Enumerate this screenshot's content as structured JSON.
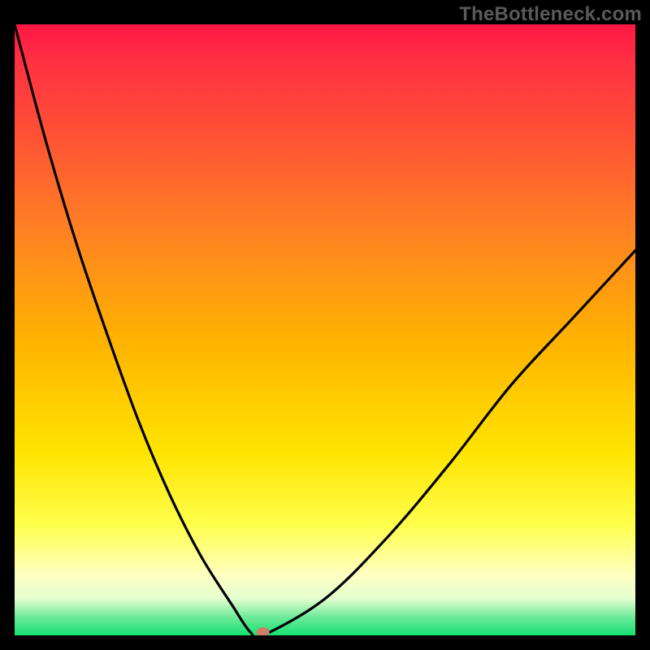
{
  "watermark": "TheBottleneck.com",
  "chart_data": {
    "type": "line",
    "title": "",
    "xlabel": "",
    "ylabel": "",
    "x": [
      0,
      5,
      10,
      15,
      20,
      25,
      30,
      35,
      38,
      40,
      50,
      60,
      70,
      80,
      90,
      100
    ],
    "values": [
      100,
      81,
      64,
      49,
      35,
      23,
      13,
      5,
      0.5,
      0,
      6,
      16,
      28,
      41,
      52,
      63
    ],
    "xlim": [
      0,
      100
    ],
    "ylim": [
      0,
      100
    ],
    "marker": {
      "x": 40,
      "y": 0
    },
    "background_gradient": {
      "type": "vertical",
      "stops": [
        {
          "pos": 0.0,
          "color": "#ff1744"
        },
        {
          "pos": 0.33,
          "color": "#ff7f24"
        },
        {
          "pos": 0.7,
          "color": "#ffe400"
        },
        {
          "pos": 0.9,
          "color": "#ffffc0"
        },
        {
          "pos": 1.0,
          "color": "#15e170"
        }
      ]
    }
  }
}
